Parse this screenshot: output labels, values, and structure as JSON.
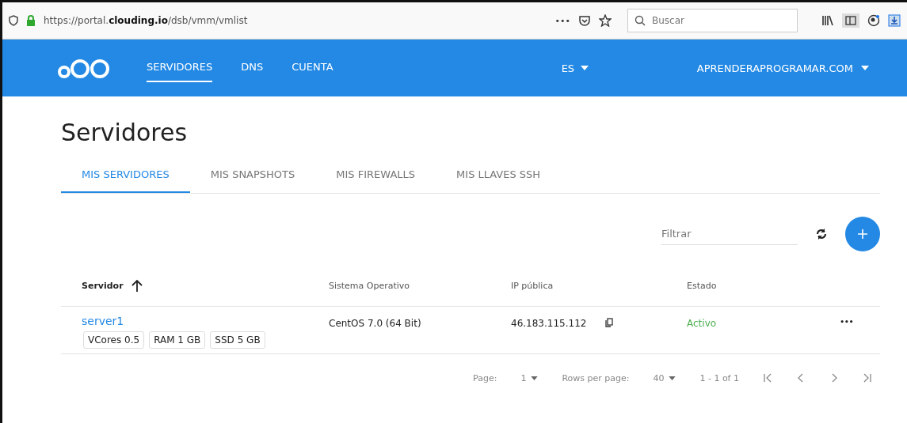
{
  "browser": {
    "url_prefix": "https://portal.",
    "url_domain": "clouding.io",
    "url_path": "/dsb/vmm/vmlist",
    "menu_dots": "•••",
    "search_placeholder": "Buscar"
  },
  "nav": {
    "items": [
      {
        "label": "SERVIDORES",
        "selected": true
      },
      {
        "label": "DNS",
        "selected": false
      },
      {
        "label": "CUENTA",
        "selected": false
      }
    ],
    "language": "ES",
    "account": "APRENDERAPROGRAMAR.COM"
  },
  "page_title": "Servidores",
  "tabs": [
    {
      "label": "MIS SERVIDORES",
      "selected": true
    },
    {
      "label": "MIS SNAPSHOTS",
      "selected": false
    },
    {
      "label": "MIS FIREWALLS",
      "selected": false
    },
    {
      "label": "MIS LLAVES SSH",
      "selected": false
    }
  ],
  "filter": {
    "placeholder": "Filtrar"
  },
  "table": {
    "columns": [
      "Servidor",
      "Sistema Operativo",
      "IP pública",
      "Estado"
    ],
    "rows": [
      {
        "name": "server1",
        "tags": [
          "VCores 0.5",
          "RAM 1 GB",
          "SSD 5 GB"
        ],
        "os": "CentOS 7.0 (64 Bit)",
        "ip": "46.183.115.112",
        "status": "Activo",
        "color": "#4caf50",
        "more": "•••"
      }
    ]
  },
  "pagination": {
    "page_label": "Page:",
    "page": "1",
    "rows_label": "Rows per page:",
    "rows": "40",
    "range": "1 - 1 of 1"
  }
}
